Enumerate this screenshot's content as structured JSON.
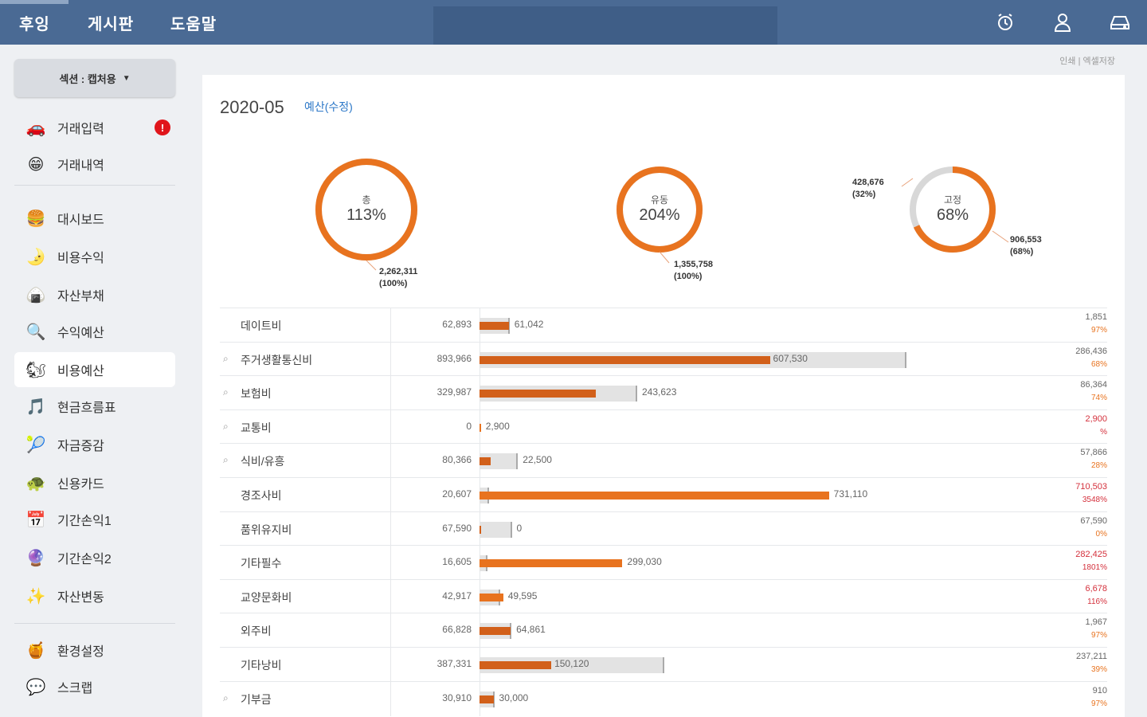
{
  "topnav": {
    "items": [
      "후잉",
      "게시판",
      "도움말"
    ]
  },
  "icons": {
    "alarm": "alarm-icon",
    "user": "user-icon",
    "drive": "hdd-icon"
  },
  "sidebar": {
    "section": "섹션 : 캡처용",
    "items": [
      {
        "label": "거래입력",
        "icon": "🚗",
        "badge": "!"
      },
      {
        "label": "거래내역",
        "icon": "😁"
      },
      {
        "label": "대시보드",
        "icon": "🍔"
      },
      {
        "label": "비용수익",
        "icon": "🌛"
      },
      {
        "label": "자산부채",
        "icon": "🍙"
      },
      {
        "label": "수익예산",
        "icon": "🔍"
      },
      {
        "label": "비용예산",
        "icon": "🐿"
      },
      {
        "label": "현금흐름표",
        "icon": "🎵"
      },
      {
        "label": "자금증감",
        "icon": "🎾"
      },
      {
        "label": "신용카드",
        "icon": "🐢"
      },
      {
        "label": "기간손익1",
        "icon": "📅"
      },
      {
        "label": "기간손익2",
        "icon": "🔮"
      },
      {
        "label": "자산변동",
        "icon": "✨"
      },
      {
        "label": "환경설정",
        "icon": "🍯"
      },
      {
        "label": "스크랩",
        "icon": "💬"
      }
    ]
  },
  "links": {
    "print": "인쇄",
    "excel": "엑셀저장"
  },
  "header": {
    "period": "2020-05",
    "budget_link": "예산(수정)"
  },
  "donuts": [
    {
      "label": "총",
      "pct": "113%",
      "value": "2,262,311",
      "value_pct": "(100%)",
      "fraction": 1.0
    },
    {
      "label": "유동",
      "pct": "204%",
      "value": "1,355,758",
      "value_pct": "(100%)",
      "fraction": 1.0
    },
    {
      "label": "고정",
      "pct": "68%",
      "value": "906,553",
      "value_pct": "(68%)",
      "fraction": 0.68,
      "rest_value": "428,676",
      "rest_pct": "(32%)"
    }
  ],
  "colors": {
    "accent": "#e8731f",
    "over": "#d4303c",
    "nav": "#4a6a94"
  },
  "rows": [
    {
      "name": "데이트비",
      "pin": false,
      "budget": "62,893",
      "actual": "61,042",
      "budget_v": 62893,
      "actual_v": 61042,
      "diff": "1,851",
      "diff_pct": "97%",
      "over": false
    },
    {
      "name": "주거생활통신비",
      "pin": true,
      "budget": "893,966",
      "actual": "607,530",
      "budget_v": 893966,
      "actual_v": 607530,
      "diff": "286,436",
      "diff_pct": "68%",
      "over": false
    },
    {
      "name": "보험비",
      "pin": true,
      "budget": "329,987",
      "actual": "243,623",
      "budget_v": 329987,
      "actual_v": 243623,
      "diff": "86,364",
      "diff_pct": "74%",
      "over": false
    },
    {
      "name": "교통비",
      "pin": true,
      "budget": "0",
      "actual": "2,900",
      "budget_v": 0,
      "actual_v": 2900,
      "diff": "2,900",
      "diff_pct": "%",
      "over": true
    },
    {
      "name": "식비/유흥",
      "pin": true,
      "budget": "80,366",
      "actual": "22,500",
      "budget_v": 80366,
      "actual_v": 22500,
      "diff": "57,866",
      "diff_pct": "28%",
      "over": false
    },
    {
      "name": "경조사비",
      "pin": false,
      "budget": "20,607",
      "actual": "731,110",
      "budget_v": 20607,
      "actual_v": 731110,
      "diff": "710,503",
      "diff_pct": "3548%",
      "over": true
    },
    {
      "name": "품위유지비",
      "pin": false,
      "budget": "67,590",
      "actual": "0",
      "budget_v": 67590,
      "actual_v": 0,
      "diff": "67,590",
      "diff_pct": "0%",
      "over": false
    },
    {
      "name": "기타필수",
      "pin": false,
      "budget": "16,605",
      "actual": "299,030",
      "budget_v": 16605,
      "actual_v": 299030,
      "diff": "282,425",
      "diff_pct": "1801%",
      "over": true
    },
    {
      "name": "교양문화비",
      "pin": false,
      "budget": "42,917",
      "actual": "49,595",
      "budget_v": 42917,
      "actual_v": 49595,
      "diff": "6,678",
      "diff_pct": "116%",
      "over": true
    },
    {
      "name": "외주비",
      "pin": false,
      "budget": "66,828",
      "actual": "64,861",
      "budget_v": 66828,
      "actual_v": 64861,
      "diff": "1,967",
      "diff_pct": "97%",
      "over": false
    },
    {
      "name": "기타낭비",
      "pin": false,
      "budget": "387,331",
      "actual": "150,120",
      "budget_v": 387331,
      "actual_v": 150120,
      "diff": "237,211",
      "diff_pct": "39%",
      "over": false
    },
    {
      "name": "기부금",
      "pin": true,
      "budget": "30,910",
      "actual": "30,000",
      "budget_v": 30910,
      "actual_v": 30000,
      "diff": "910",
      "diff_pct": "97%",
      "over": false
    }
  ]
}
